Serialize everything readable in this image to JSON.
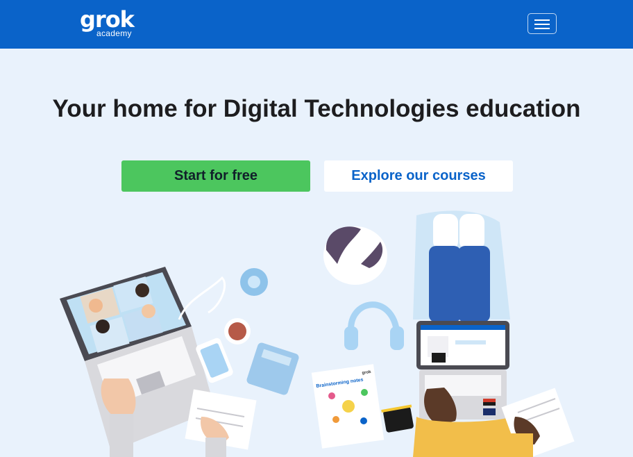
{
  "nav": {
    "logo_text": "grok",
    "logo_subtext": "academy",
    "menu_icon": "hamburger-menu-icon"
  },
  "hero": {
    "title": "Your home for Digital Technologies education",
    "start_button": "Start for free",
    "explore_button": "Explore our courses"
  },
  "illustration": {
    "worksheet_title": "Brainstorming notes",
    "worksheet_brand": "grok"
  },
  "colors": {
    "nav_bg": "#0a63c9",
    "page_bg": "#e9f2fc",
    "primary_green": "#4cc65e",
    "link_blue": "#0a63c9"
  }
}
